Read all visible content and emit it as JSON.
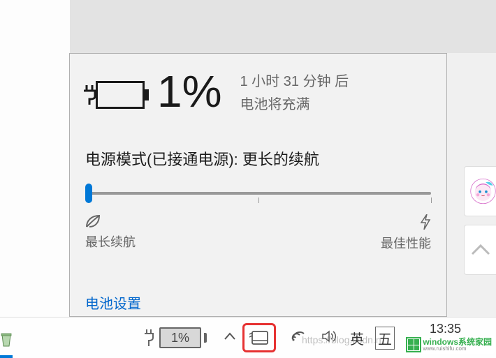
{
  "battery": {
    "percent": "1%",
    "time_remaining": "1 小时 31 分钟  后",
    "status_text": "电池将充满",
    "power_mode_label": "电源模式(已接通电源): 更长的续航",
    "slider": {
      "left_label": "最长续航",
      "right_label": "最佳性能",
      "position_percent": 0
    },
    "settings_link": "电池设置"
  },
  "taskbar": {
    "tray_battery_percent": "1%",
    "ime_lang": "英",
    "ime_method": "五",
    "clock": "13:35"
  },
  "watermark": {
    "url": "https://blog.csdn.n",
    "brand_line1": "windows系统家园",
    "brand_line2": "www.ruishifu.com"
  }
}
